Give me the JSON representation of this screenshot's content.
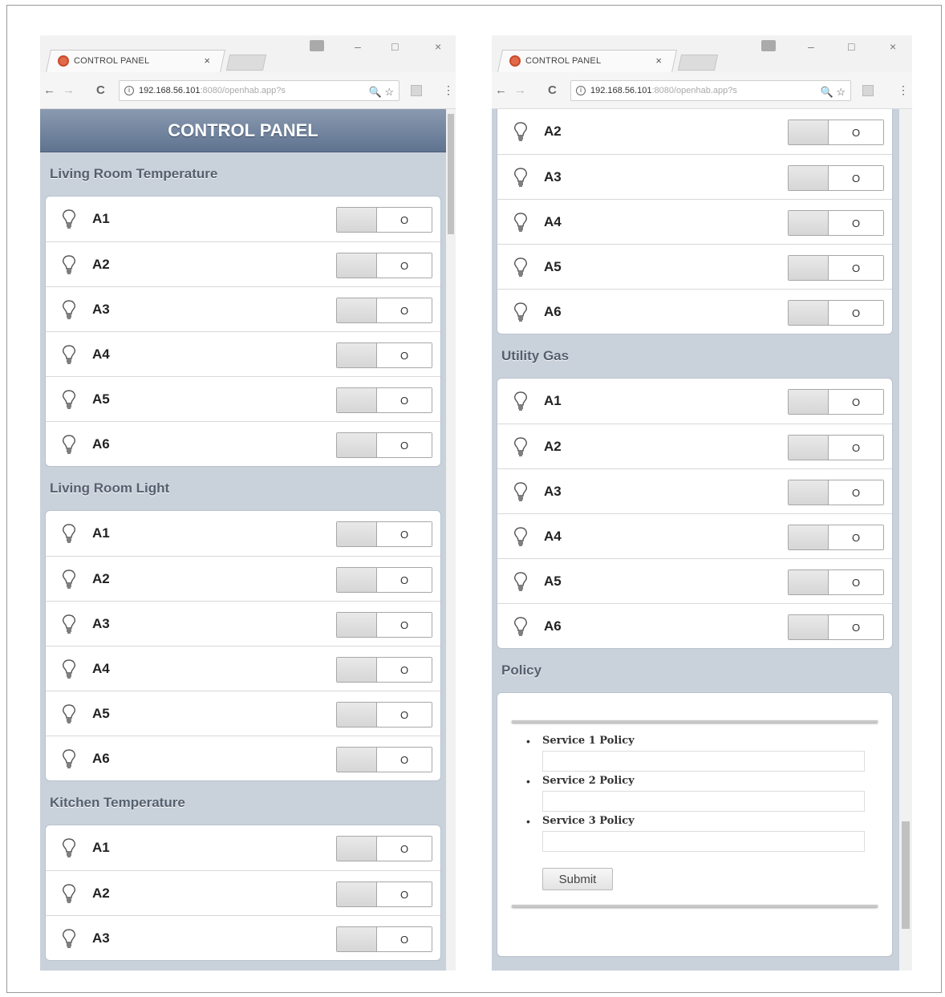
{
  "browser": {
    "tab_title": "CONTROL PANEL",
    "tab_close": "×",
    "url_host": "192.168.56.101",
    "url_rest": ":8080/openhab.app?s",
    "back": "←",
    "forward": "→",
    "reload": "C",
    "zoom_icon": "🔍",
    "star_icon": "☆",
    "menu": "⋮",
    "minimize": "–",
    "maximize": "□",
    "close": "×"
  },
  "left": {
    "header": "CONTROL PANEL",
    "sections": [
      {
        "title": "Living Room Temperature",
        "items": [
          "A1",
          "A2",
          "A3",
          "A4",
          "A5",
          "A6"
        ]
      },
      {
        "title": "Living Room Light",
        "items": [
          "A1",
          "A2",
          "A3",
          "A4",
          "A5",
          "A6"
        ]
      },
      {
        "title": "Kitchen Temperature",
        "items": [
          "A1",
          "A2",
          "A3"
        ]
      }
    ]
  },
  "right": {
    "continued_items": [
      "A2",
      "A3",
      "A4",
      "A5",
      "A6"
    ],
    "sections": [
      {
        "title": "Utility Gas",
        "items": [
          "A1",
          "A2",
          "A3",
          "A4",
          "A5",
          "A6"
        ]
      }
    ],
    "policy": {
      "title": "Policy",
      "fields": [
        "Service 1 Policy",
        "Service 2 Policy",
        "Service 3 Policy"
      ],
      "submit": "Submit"
    }
  },
  "toggle_symbol": "O",
  "icons": {
    "item": "light-bulb-icon"
  }
}
